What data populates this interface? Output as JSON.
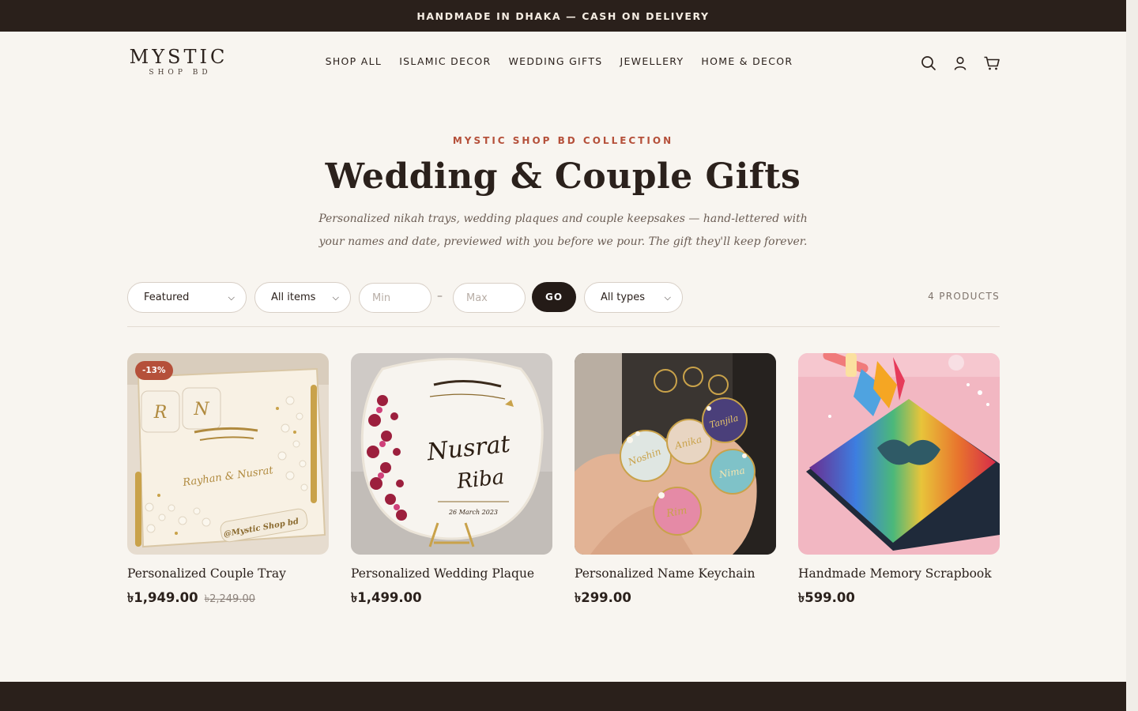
{
  "announcement": "HANDMADE IN DHAKA — CASH ON DELIVERY",
  "logo": {
    "main": "MYSTIC",
    "sub": "SHOP BD"
  },
  "nav": [
    "SHOP ALL",
    "ISLAMIC DECOR",
    "WEDDING GIFTS",
    "JEWELLERY",
    "HOME & DECOR"
  ],
  "header_icons": [
    "search-icon",
    "account-icon",
    "cart-icon"
  ],
  "hero": {
    "eyebrow": "MYSTIC SHOP BD COLLECTION",
    "title": "Wedding & Couple Gifts",
    "description": "Personalized nikah trays, wedding plaques and couple keepsakes — hand-lettered with your names and date, previewed with you before we pour. The gift they'll keep forever."
  },
  "filters": {
    "sort": "Featured",
    "availability": "All items",
    "min_placeholder": "Min",
    "max_placeholder": "Max",
    "dash": "–",
    "go": "GO",
    "type": "All types",
    "count": "4 PRODUCTS"
  },
  "products": [
    {
      "name": "Personalized Couple Tray",
      "price": "৳1,949.00",
      "old_price": "৳2,249.00",
      "badge": "-13%"
    },
    {
      "name": "Personalized Wedding Plaque",
      "price": "৳1,499.00",
      "old_price": "",
      "badge": ""
    },
    {
      "name": "Personalized Name Keychain",
      "price": "৳299.00",
      "old_price": "",
      "badge": ""
    },
    {
      "name": "Handmade Memory Scrapbook",
      "price": "৳599.00",
      "old_price": "",
      "badge": ""
    }
  ],
  "image_text": {
    "tray_initials": [
      "R",
      "N"
    ],
    "tray_names": "Rayhan & Nusrat",
    "tray_tag": "@Mystic Shop bd",
    "plaque_names": [
      "Nusrat",
      "Riba"
    ],
    "plaque_date": "26 March 2023",
    "keychain_names": [
      "Noshin",
      "Anika",
      "Tanjila",
      "Nima",
      "Rim"
    ]
  },
  "colors": {
    "accent": "#b5503a",
    "dark": "#2a201b",
    "background": "#f8f5f0"
  }
}
